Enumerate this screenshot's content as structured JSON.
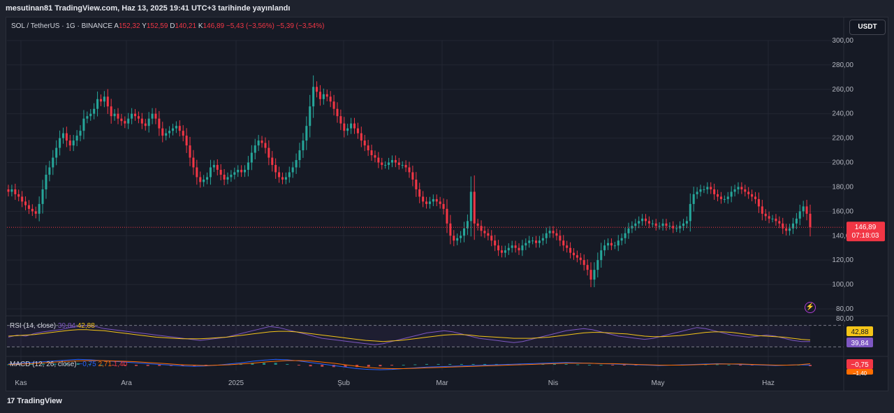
{
  "caption": "mesutinan81 TradingView.com, Haz 13, 2025 19:41 UTC+3 tarihinde yayınlandı",
  "legend": {
    "symbol": "SOL / TetherUS · 1G · BINANCE",
    "open_label": "A",
    "open": "152,32",
    "high_label": "Y",
    "high": "152,59",
    "low_label": "D",
    "low": "140,21",
    "close_label": "K",
    "close": "146,89",
    "change": "−5,43 (−3,56%)",
    "change2": "−5,39 (−3,54%)"
  },
  "currency_button": "USDT",
  "footer_brand": "TradingView",
  "colors": {
    "up": "#26a69a",
    "down": "#f23645",
    "rsi_line": "#7e57c2",
    "rsi_ma": "#f5c518",
    "macd_line": "#2962ff",
    "signal_line": "#ff6d00",
    "price_tag": "#f23645"
  },
  "chart_data": {
    "type": "candlestick",
    "price_axis_ticks": [
      "300,00",
      "280,00",
      "260,00",
      "240,00",
      "220,00",
      "200,00",
      "180,00",
      "160,00",
      "140,00",
      "120,00",
      "100,00",
      "80,00"
    ],
    "ylim": [
      80,
      300
    ],
    "x_labels": [
      "Kas",
      "Ara",
      "2025",
      "Şub",
      "Mar",
      "Nis",
      "May",
      "Haz"
    ],
    "last_price": "146,89",
    "countdown": "07:18:03",
    "close_series": [
      176,
      178,
      174,
      172,
      168,
      165,
      162,
      160,
      158,
      166,
      178,
      190,
      196,
      204,
      212,
      220,
      224,
      218,
      214,
      218,
      222,
      226,
      236,
      238,
      240,
      244,
      252,
      250,
      254,
      246,
      238,
      240,
      236,
      234,
      232,
      236,
      240,
      238,
      236,
      232,
      230,
      236,
      240,
      236,
      228,
      222,
      224,
      226,
      228,
      230,
      226,
      222,
      214,
      204,
      196,
      188,
      184,
      186,
      188,
      196,
      198,
      194,
      190,
      186,
      188,
      190,
      192,
      194,
      192,
      194,
      200,
      208,
      214,
      218,
      216,
      212,
      204,
      198,
      192,
      188,
      186,
      188,
      192,
      196,
      202,
      210,
      218,
      230,
      246,
      262,
      258,
      252,
      256,
      254,
      250,
      244,
      238,
      232,
      226,
      228,
      232,
      228,
      224,
      218,
      214,
      210,
      206,
      204,
      200,
      198,
      198,
      200,
      202,
      200,
      198,
      198,
      196,
      192,
      186,
      178,
      172,
      168,
      166,
      168,
      170,
      168,
      166,
      162,
      150,
      140,
      136,
      138,
      140,
      146,
      152,
      176,
      150,
      148,
      144,
      142,
      140,
      136,
      132,
      128,
      126,
      128,
      130,
      132,
      130,
      128,
      132,
      134,
      136,
      136,
      134,
      136,
      138,
      142,
      144,
      142,
      140,
      136,
      132,
      130,
      126,
      124,
      122,
      120,
      116,
      112,
      104,
      112,
      120,
      128,
      132,
      134,
      132,
      132,
      136,
      138,
      142,
      146,
      148,
      150,
      152,
      154,
      152,
      150,
      150,
      148,
      148,
      150,
      148,
      148,
      146,
      146,
      148,
      150,
      152,
      166,
      174,
      176,
      178,
      178,
      180,
      178,
      174,
      172,
      170,
      170,
      172,
      176,
      178,
      180,
      178,
      176,
      174,
      172,
      170,
      164,
      158,
      156,
      154,
      154,
      152,
      150,
      146,
      144,
      146,
      150,
      154,
      160,
      164,
      158,
      146.89
    ],
    "rsi": {
      "label": "RSI (14, close)",
      "value": "39,84",
      "ma_value": "42,88",
      "levels": [
        70,
        30
      ],
      "ylim": [
        20,
        80
      ],
      "top_tick": "80,00",
      "series": [
        48,
        52,
        50,
        55,
        58,
        60,
        62,
        66,
        68,
        70,
        68,
        64,
        62,
        60,
        58,
        56,
        54,
        52,
        50,
        48,
        46,
        44,
        42,
        44,
        46,
        48,
        52,
        56,
        60,
        64,
        68,
        66,
        62,
        58,
        54,
        50,
        46,
        44,
        42,
        40,
        38,
        36,
        34,
        36,
        40,
        44,
        48,
        52,
        56,
        58,
        60,
        58,
        54,
        50,
        46,
        44,
        42,
        40,
        38,
        40,
        44,
        48,
        52,
        56,
        60,
        62,
        64,
        62,
        58,
        54,
        50,
        48,
        46,
        44,
        46,
        50,
        54,
        58,
        62,
        66,
        64,
        60,
        56,
        52,
        50,
        48,
        50,
        52,
        50,
        46,
        42,
        40,
        39.84
      ],
      "ma_series": [
        50,
        51,
        52,
        53,
        55,
        57,
        59,
        61,
        62,
        62,
        61,
        60,
        58,
        56,
        54,
        52,
        50,
        48,
        47,
        46,
        45,
        45,
        45,
        46,
        47,
        48,
        50,
        52,
        54,
        56,
        58,
        59,
        59,
        58,
        56,
        54,
        52,
        50,
        48,
        46,
        44,
        42,
        41,
        40,
        41,
        42,
        44,
        46,
        48,
        50,
        52,
        53,
        53,
        52,
        50,
        49,
        48,
        47,
        46,
        46,
        46,
        47,
        48,
        50,
        52,
        54,
        56,
        57,
        57,
        56,
        55,
        54,
        52,
        50,
        49,
        49,
        50,
        51,
        53,
        55,
        57,
        58,
        58,
        57,
        55,
        53,
        51,
        50,
        49,
        48,
        46,
        44,
        42.88
      ]
    },
    "macd": {
      "label": "MACD (12, 26, close)",
      "macd_value": "−0,75",
      "signal_value": "2,71",
      "hist_value": "1,40",
      "axis_value": "−0,75",
      "axis_value2": "−1,40",
      "macd_series": [
        2,
        4,
        6,
        8,
        10,
        12,
        14,
        13,
        11,
        9,
        7,
        5,
        3,
        1,
        -1,
        -3,
        -4,
        -3,
        -1,
        2,
        5,
        9,
        12,
        14,
        13,
        10,
        6,
        2,
        -2,
        -6,
        -10,
        -12,
        -13,
        -12,
        -10,
        -8,
        -6,
        -5,
        -4,
        -3,
        -2,
        -1,
        0,
        1,
        2,
        3,
        4,
        5,
        6,
        5,
        4,
        3,
        2,
        1,
        0,
        -1,
        -2,
        -1,
        0,
        1,
        2,
        3,
        2,
        1,
        0,
        -1,
        -2,
        -1,
        0,
        -0.75
      ],
      "signal_series": [
        1,
        2,
        3,
        5,
        7,
        9,
        10,
        11,
        11,
        10,
        9,
        8,
        6,
        4,
        2,
        0,
        -1,
        -2,
        -1,
        0,
        2,
        4,
        7,
        9,
        11,
        11,
        10,
        7,
        4,
        0,
        -4,
        -7,
        -9,
        -10,
        -10,
        -9,
        -8,
        -7,
        -6,
        -5,
        -4,
        -3,
        -2,
        -1,
        0,
        1,
        2,
        3,
        4,
        4,
        4,
        3,
        3,
        2,
        1,
        0,
        -1,
        -1,
        -1,
        0,
        1,
        2,
        2,
        2,
        1,
        0,
        -1,
        -1,
        0,
        2.71
      ]
    }
  }
}
